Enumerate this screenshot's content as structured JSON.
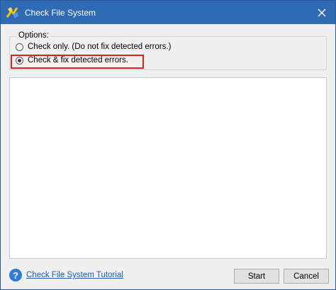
{
  "window": {
    "title": "Check File System",
    "app_icon": "partition-wizard-icon",
    "close_glyph": "✕"
  },
  "options": {
    "legend": "Options:",
    "items": [
      {
        "label": "Check only. (Do not fix detected errors.)",
        "selected": false
      },
      {
        "label": "Check & fix detected errors.",
        "selected": true
      }
    ]
  },
  "footer": {
    "help_glyph": "?",
    "tutorial_link": "Check File System Tutorial",
    "start_label": "Start",
    "cancel_label": "Cancel"
  },
  "colors": {
    "titlebar": "#2f6ab5",
    "highlight": "#e02020",
    "link": "#1a5fb4"
  }
}
